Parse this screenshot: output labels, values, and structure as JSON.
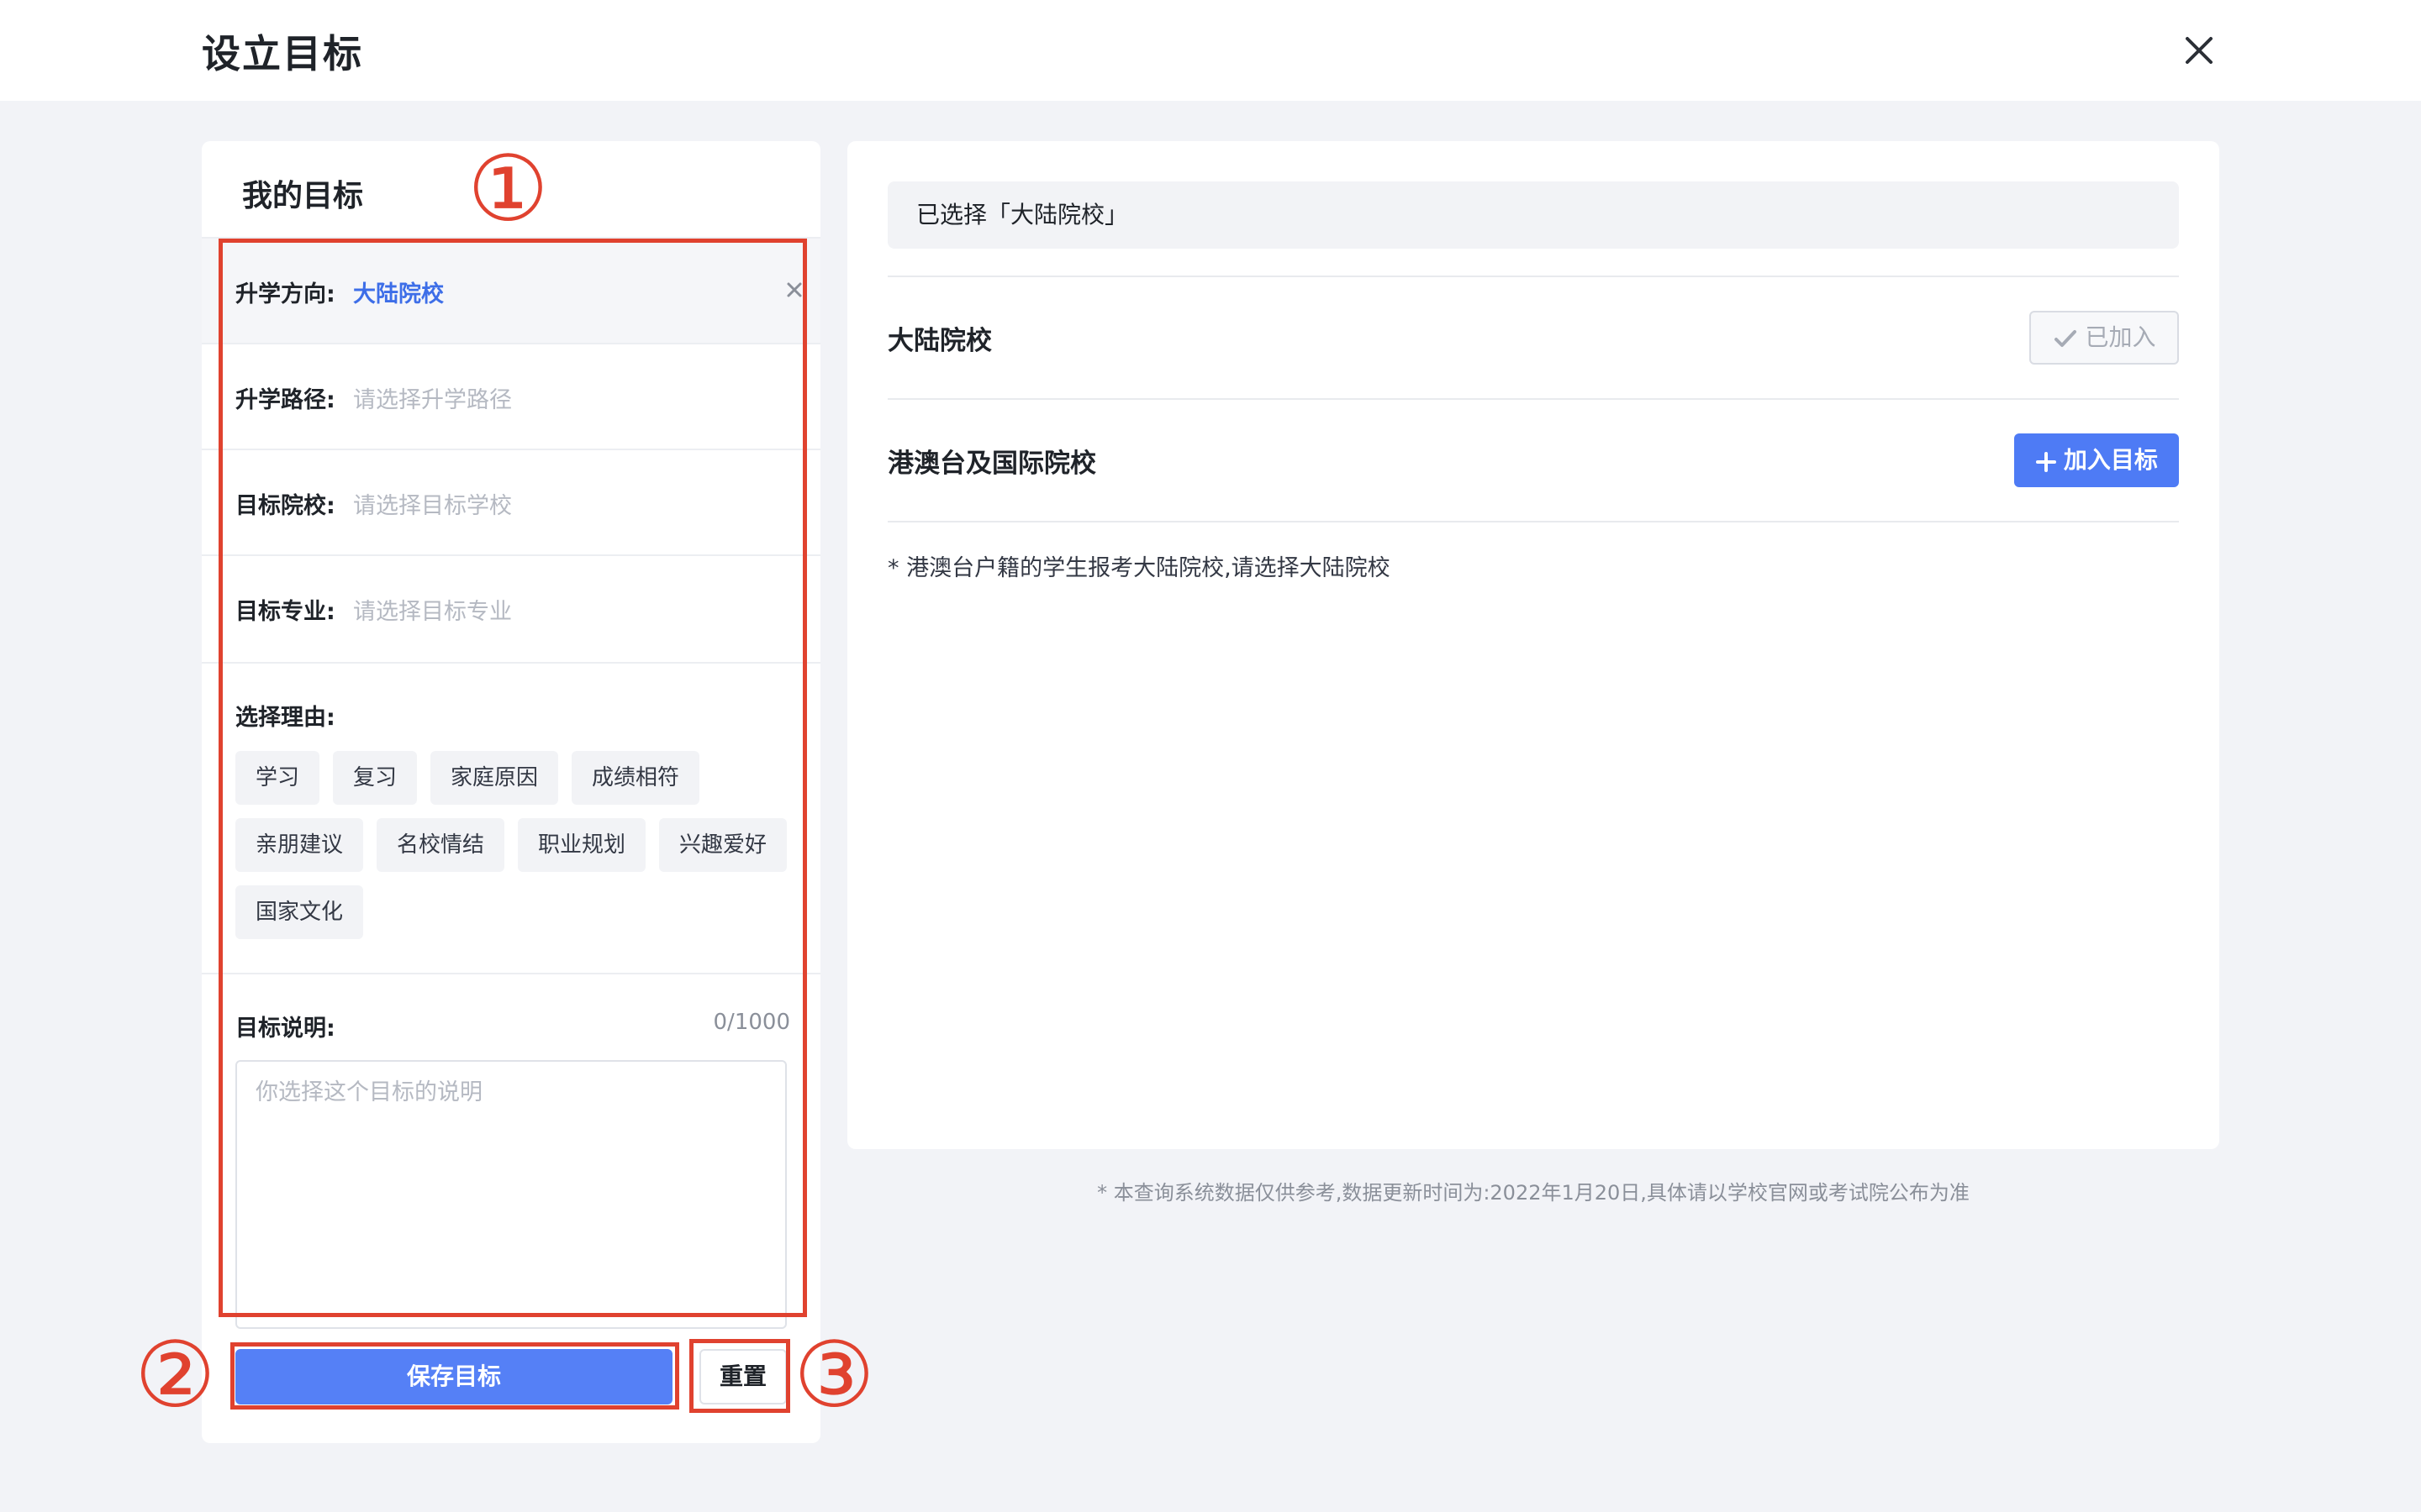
{
  "header": {
    "title": "设立目标",
    "close_icon": "close-icon"
  },
  "left": {
    "title": "我的目标",
    "direction": {
      "label": "升学方向:",
      "value": "大陆院校"
    },
    "path": {
      "label": "升学路径:",
      "placeholder": "请选择升学路径"
    },
    "school": {
      "label": "目标院校:",
      "placeholder": "请选择目标学校"
    },
    "major": {
      "label": "目标专业:",
      "placeholder": "请选择目标专业"
    },
    "reasons": {
      "label": "选择理由:",
      "tags": [
        "学习",
        "复习",
        "家庭原因",
        "成绩相符",
        "亲朋建议",
        "名校情结",
        "职业规划",
        "兴趣爱好",
        "国家文化"
      ]
    },
    "description": {
      "label": "目标说明:",
      "counter": "0/1000",
      "placeholder": "你选择这个目标的说明"
    },
    "save_label": "保存目标",
    "reset_label": "重置"
  },
  "right": {
    "selected_text": "已选择「大陆院校」",
    "mainland": {
      "title": "大陆院校",
      "button": "已加入"
    },
    "international": {
      "title": "港澳台及国际院校",
      "button": "加入目标"
    },
    "note": "* 港澳台户籍的学生报考大陆院校,请选择大陆院校"
  },
  "footer_note": "* 本查询系统数据仅供参考,数据更新时间为:2022年1月20日,具体请以学校官网或考试院公布为准",
  "annotations": [
    "①",
    "②",
    "③"
  ],
  "colors": {
    "accent": "#4e7bf5",
    "annotation": "#e0422f",
    "background": "#f2f3f7"
  }
}
